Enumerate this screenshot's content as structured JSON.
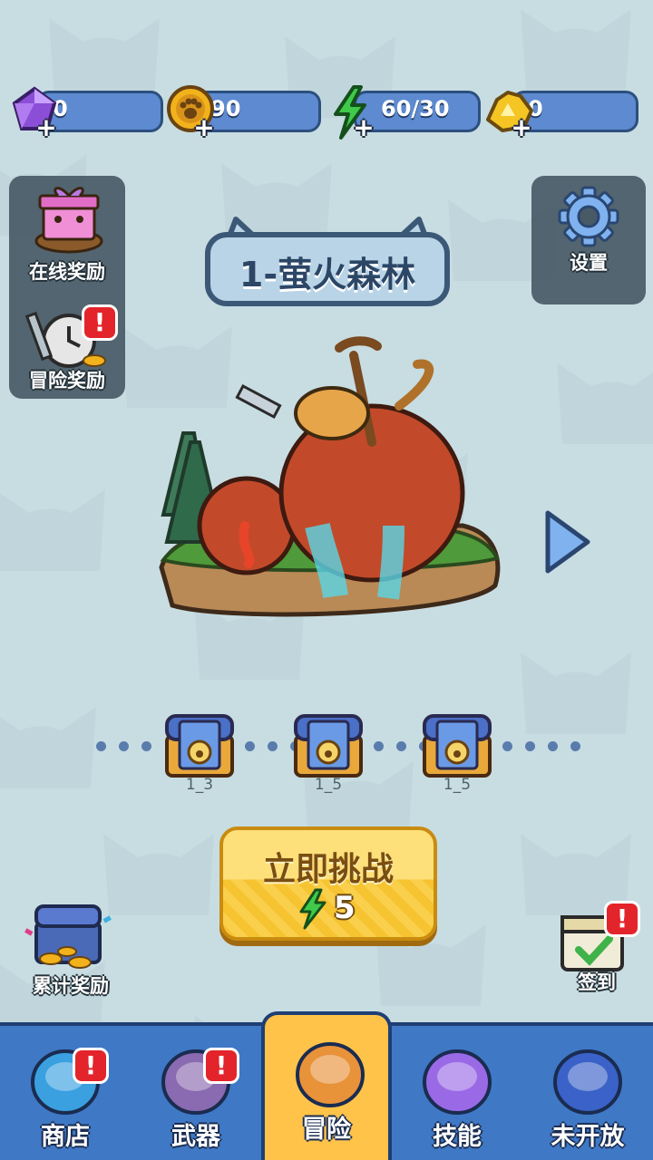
{
  "currencies": [
    {
      "name": "gems",
      "value": "0",
      "icon": "gem-icon",
      "color": "#9b5ce0"
    },
    {
      "name": "coins",
      "value": "90",
      "icon": "paw-coin-icon",
      "color": "#f0b21a"
    },
    {
      "name": "energy",
      "value": "60/30",
      "icon": "energy-icon",
      "color": "#3fca4a"
    },
    {
      "name": "gold",
      "value": "0",
      "icon": "gold-nugget-icon",
      "color": "#f5c524"
    }
  ],
  "left_menu": {
    "online_reward": "在线奖励",
    "adventure_reward": "冒险奖励",
    "cumulative_reward": "累计奖励"
  },
  "right_menu": {
    "settings": "设置",
    "sign_in": "签到"
  },
  "badge_mark": "!",
  "level": {
    "title": "1-萤火森林"
  },
  "milestones": [
    {
      "label": "1_3"
    },
    {
      "label": "1_5"
    },
    {
      "label": "1_5"
    }
  ],
  "challenge": {
    "label": "立即挑战",
    "cost": "5"
  },
  "bottom_nav": [
    {
      "label": "商店",
      "icon": "shop-icon",
      "badge": true
    },
    {
      "label": "武器",
      "icon": "weapon-icon",
      "badge": true
    },
    {
      "label": "冒险",
      "icon": "cat-warrior-icon",
      "active": true
    },
    {
      "label": "技能",
      "icon": "skill-orb-icon"
    },
    {
      "label": "未开放",
      "icon": "locked-icon"
    }
  ]
}
